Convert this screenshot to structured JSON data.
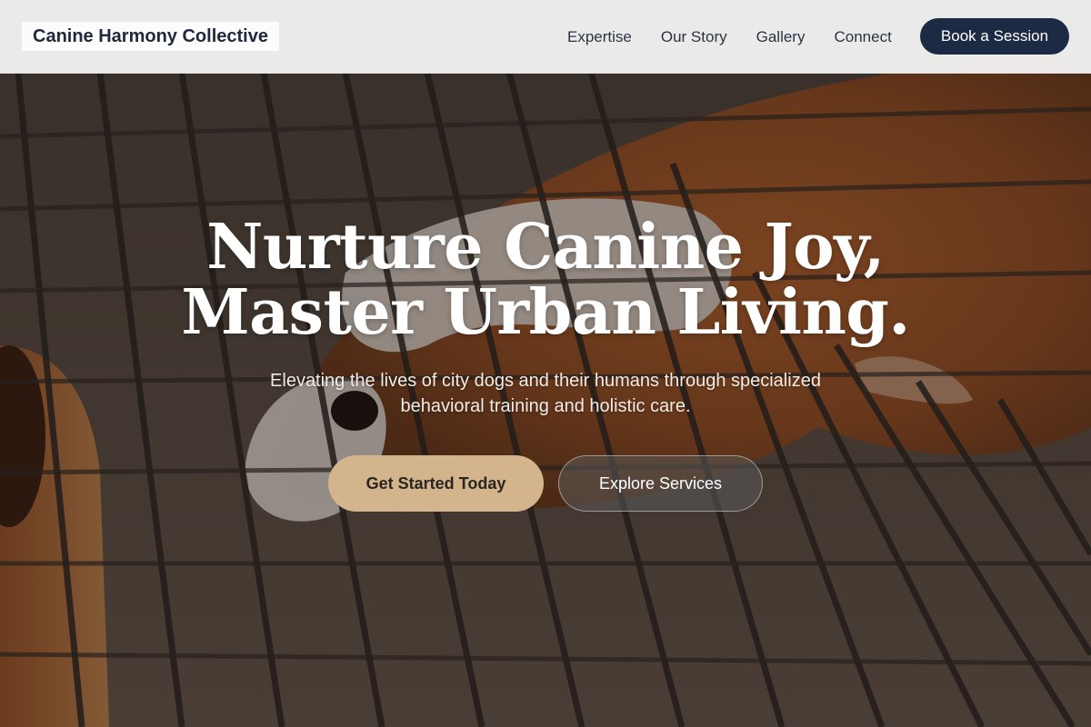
{
  "navbar": {
    "brand": "Canine Harmony Collective",
    "links": [
      "Expertise",
      "Our Story",
      "Gallery",
      "Connect"
    ],
    "cta_label": "Book a Session"
  },
  "hero": {
    "title_line1": "Nurture Canine Joy,",
    "title_line2": "Master Urban Living.",
    "subtitle_line1": "Elevating the lives of city dogs and their humans through specialized",
    "subtitle_line2": "behavioral training and holistic care.",
    "primary_button": "Get Started Today",
    "secondary_button": "Explore Services",
    "background_image": "guinea-pig-on-wire-grate-photo"
  },
  "colors": {
    "navbar_bg": "#f6f6f6",
    "brand_text": "#1e293b",
    "cta_bg": "#1c2a44",
    "primary_button_bg": "#d4b48c",
    "hero_text": "#ffffff"
  }
}
